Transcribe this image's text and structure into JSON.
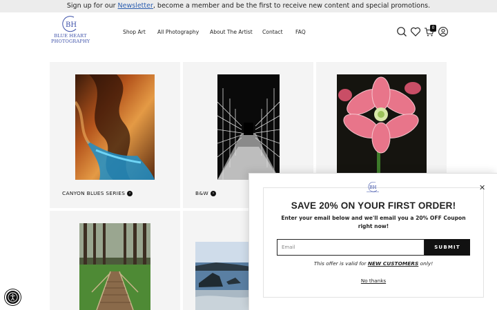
{
  "announcement": {
    "prefix": "Sign up for our ",
    "link": "Newsletter",
    "suffix": ", become a member and be the first to receive new content and special promotions."
  },
  "brand": {
    "mark": "BH",
    "line1": "BLUE HEART",
    "line2": "PHOTOGRAPHY",
    "accent": "#3b4fa8"
  },
  "nav": [
    {
      "label": "Shop Art"
    },
    {
      "label": "All Photography"
    },
    {
      "label": "About The Artist"
    },
    {
      "label": "Contact"
    },
    {
      "label": "FAQ"
    }
  ],
  "header_icons": [
    "search-icon",
    "heart-icon",
    "cart-icon",
    "account-icon"
  ],
  "cart_count": "0",
  "products": [
    {
      "title": "CANYON BLUES SERIES",
      "image": "canyon-photo"
    },
    {
      "title": "B&W",
      "image": "bridge-bw-photo"
    },
    {
      "title": "",
      "image": "amaryllis-flower-photo"
    },
    {
      "title": "",
      "image": "forest-boardwalk-photo"
    },
    {
      "title": "",
      "image": "seascape-photo"
    }
  ],
  "popup": {
    "heading": "SAVE 20% ON YOUR FIRST ORDER!",
    "body": "Enter your email below and we'll email you a 20% OFF Coupon right now!",
    "email_placeholder": "Email",
    "submit_label": "SUBMIT",
    "offer_prefix": "This offer is valid for ",
    "offer_strong": "NEW CUSTOMERS",
    "offer_suffix": " only!",
    "no_thanks": "No thanks",
    "close_glyph": "✕"
  }
}
